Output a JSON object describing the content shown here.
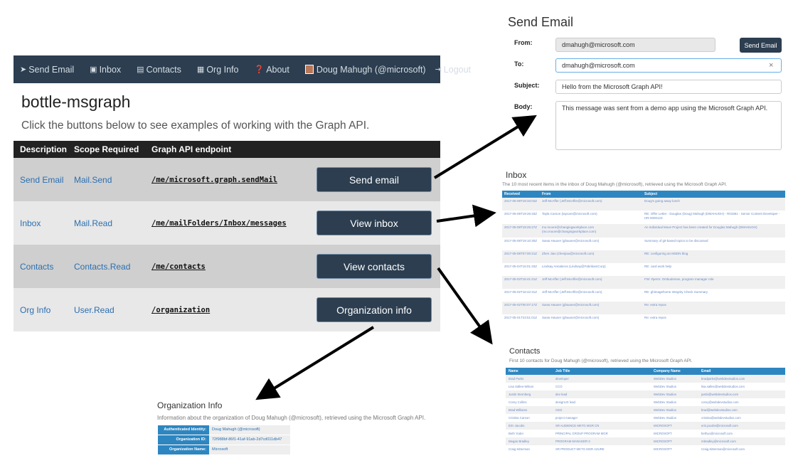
{
  "nav": {
    "items": [
      {
        "icon": "send-icon",
        "glyph": "➤",
        "label": "Send Email"
      },
      {
        "icon": "inbox-icon",
        "glyph": "▣",
        "label": "Inbox"
      },
      {
        "icon": "contacts-icon",
        "glyph": "▤",
        "label": "Contacts"
      },
      {
        "icon": "org-icon",
        "glyph": "▦",
        "label": "Org Info"
      },
      {
        "icon": "about-icon",
        "glyph": "❓",
        "label": "About"
      }
    ],
    "user_label": "Doug Mahugh (@microsoft)",
    "logout_glyph": "⇥",
    "logout_label": "Logout"
  },
  "main": {
    "title": "bottle-msgraph",
    "subtitle": "Click the buttons below to see examples of working with the Graph API.",
    "table": {
      "headers": [
        "Description",
        "Scope Required",
        "Graph API endpoint"
      ],
      "rows": [
        {
          "description": "Send Email",
          "scope": "Mail.Send",
          "endpoint": "/me/microsoft.graph.sendMail",
          "button": "Send email"
        },
        {
          "description": "Inbox",
          "scope": "Mail.Read",
          "endpoint": "/me/mailFolders/Inbox/messages",
          "button": "View inbox"
        },
        {
          "description": "Contacts",
          "scope": "Contacts.Read",
          "endpoint": "/me/contacts",
          "button": "View contacts"
        },
        {
          "description": "Org Info",
          "scope": "User.Read",
          "endpoint": "/organization",
          "button": "Organization info"
        }
      ]
    }
  },
  "send_email": {
    "title": "Send Email",
    "from_label": "From:",
    "from_value": "dmahugh@microsoft.com",
    "to_label": "To:",
    "to_value": "dmahugh@microsoft.com",
    "clear_glyph": "×",
    "subject_label": "Subject:",
    "subject_value": "Hello from the Microsoft Graph API!",
    "body_label": "Body:",
    "body_value": "This message was sent from a demo app using the Microsoft Graph API.",
    "button": "Send Email"
  },
  "inbox": {
    "title": "Inbox",
    "description": "The 10 most recent items in the inbox of Doug Mahugh (@microsoft), retrieved using the Microsoft Graph API.",
    "headers": [
      "Received",
      "From",
      "Subject"
    ],
    "rows": [
      {
        "received": "2017-05-08T19:33:04Z",
        "from": "Jeff McAffer (Jeff.McAffer@microsoft.com)",
        "subject": "Doug's going away lunch"
      },
      {
        "received": "2017-05-08T19:26:33Z",
        "from": "Tayla Carson (taycars@microsoft.com)",
        "subject": "RE: Offer Letter - Douglas (Doug) Mahugh (DMAHUGH) - R01861 - Senior Content Developer - HR-0000123"
      },
      {
        "received": "2017-05-08T19:25:27Z",
        "from": "mo.moore@changingworkplace.com (mo.moore@changingworkplace.com)",
        "subject": "An Individual Move Project has been created for Douglas Mahugh (DMAHUGH)"
      },
      {
        "received": "2017-05-08T19:10:30Z",
        "from": "Sanai Hauser (ghauser@microsoft.com)",
        "subject": "Summary of git-based topics to be discussed"
      },
      {
        "received": "2017-05-08T07:00:21Z",
        "from": "Zhen Jiao (zhenjiao@microsoft.com)",
        "subject": "RE: configuring an MSDN blog"
      },
      {
        "received": "2017-05-04T16:01:33Z",
        "from": "Lindsay Annaleros (Lindsay@FabrikamCorp)",
        "subject": "RE: card work help"
      },
      {
        "received": "2017-05-03T16:41:21Z",
        "from": "Jeff McAffer (Jeff.McAffer@microsoft.com)",
        "subject": "FW: #perm: Ombudsman, program manager role"
      },
      {
        "received": "2017-05-02T18:42:31Z",
        "from": "Jeff McAffer (Jeff.McAffer@microsoft.com)",
        "subject": "RE: ghimagehome Integrity Check Summary"
      },
      {
        "received": "2017-05-02T00:07:17Z",
        "from": "Sanai Hauser (ghauser@microsoft.com)",
        "subject": "Re: extra repos"
      },
      {
        "received": "2017-05-01T23:51:01Z",
        "from": "Sanai Hauser (ghauser@microsoft.com)",
        "subject": "Re: extra repos"
      }
    ]
  },
  "contacts": {
    "title": "Contacts",
    "description": "First 10 contacts for Doug Mahugh (@microsoft), retrieved using the Microsoft Graph API.",
    "headers": [
      "Name",
      "Job Title",
      "Company Name",
      "Email"
    ],
    "rows": [
      {
        "name": "Brad Parks",
        "title": "developer",
        "company": "WebDev Studios",
        "email": "bradparks@webdevstudios.com"
      },
      {
        "name": "Lisa Sallee-Wilson",
        "title": "CCO",
        "company": "WebDev Studios",
        "email": "lisa.sallee@webdevstudios.com"
      },
      {
        "name": "Justin Sternberg",
        "title": "dev lead",
        "company": "WebDev Studios",
        "email": "justin@webdevstudios.com"
      },
      {
        "name": "Corey Collins",
        "title": "designUX lead",
        "company": "WebDev Studios",
        "email": "corey@webdevstudios.com"
      },
      {
        "name": "Brad Williams",
        "title": "CEO",
        "company": "WebDev Studios",
        "email": "brad@webdevstudios.com"
      },
      {
        "name": "Cristina Carson",
        "title": "project manager",
        "company": "WebDev Studios",
        "email": "cristina@webdevstudios.com"
      },
      {
        "name": "Erin Jacobs",
        "title": "SR AUDIENCE MKTG MGR CN",
        "company": "MICROSOFT",
        "email": "erin.jacobs@microsoft.com"
      },
      {
        "name": "Beth Yoder",
        "title": "PRINCIPAL GROUP PROGRAM MGR",
        "company": "MICROSOFT",
        "email": "bethyo@microsoft.com"
      },
      {
        "name": "Megan Bradley",
        "title": "PROGRAM MANAGER II",
        "company": "MICROSOFT",
        "email": "mbradley@microsoft.com"
      },
      {
        "name": "Craig Kitterman",
        "title": "SR PRODUCT MKTG MGR AZURE",
        "company": "MICROSOFT",
        "email": "Craig.Kitterman@microsoft.com"
      }
    ]
  },
  "org_info": {
    "title": "Organization Info",
    "description": "Information about the organization of Doug Mahugh (@microsoft), retrieved using the Microsoft Graph API.",
    "rows": [
      {
        "key": "Authenticated Identity:",
        "value": "Doug Mahugh (@microsoft)"
      },
      {
        "key": "Organization ID:",
        "value": "72f988bf-86f1-41af-91ab-2d7cd011db47"
      },
      {
        "key": "Organization Name:",
        "value": "Microsoft"
      }
    ]
  },
  "colors": {
    "navbar": "#2c3e50",
    "table_header_blue": "#2e86c1",
    "link_blue": "#2c6fb0",
    "arrow": "#000000"
  }
}
